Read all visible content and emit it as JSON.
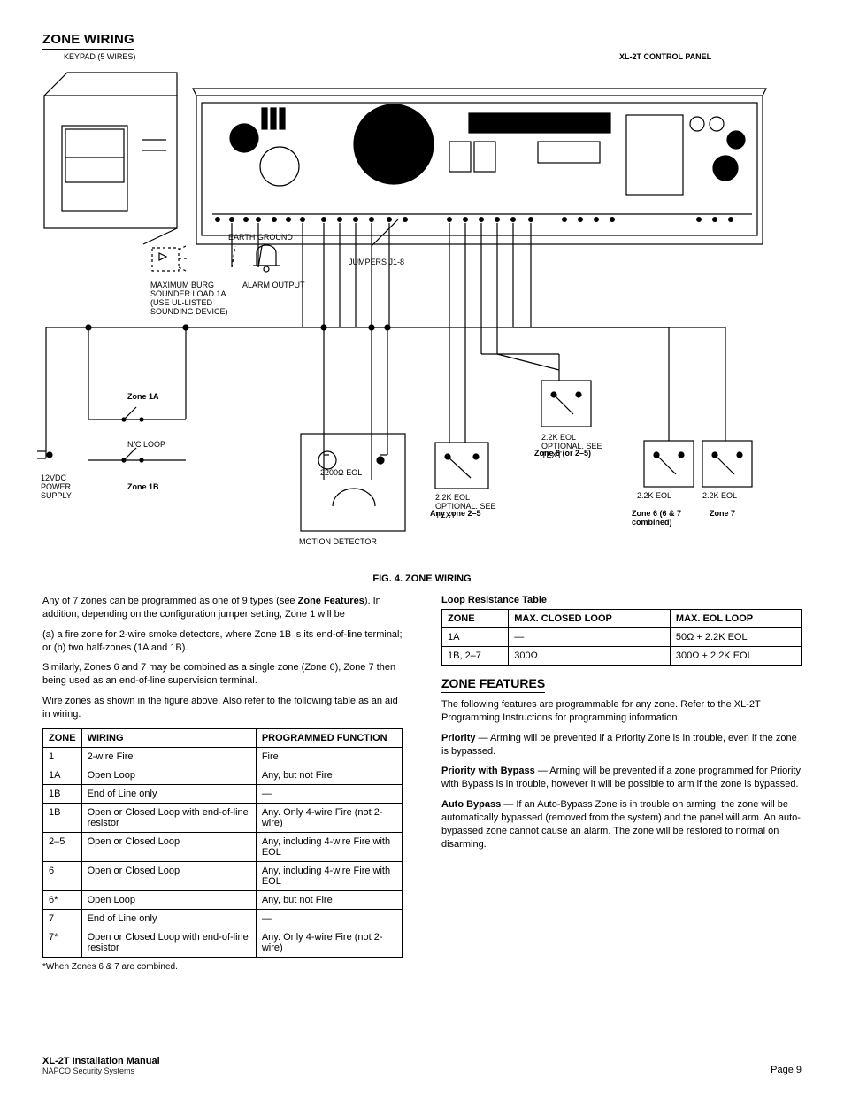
{
  "page": {
    "title": "ZONE WIRING",
    "footer_line1": "XL-2T Installation Manual",
    "footer_line2": "NAPCO Security Systems",
    "page_number": "Page 9"
  },
  "diagram": {
    "figure_caption": "FIG. 4.  ZONE WIRING",
    "keypad_label": "KEYPAD (5 WIRES)",
    "control_label": "XL-2T CONTROL PANEL",
    "jumper_label": "JUMPERS J1-8",
    "earth_label": "EARTH GROUND",
    "siren_note": "MAXIMUM BURG SOUNDER LOAD 1A (USE UL-LISTED SOUNDING DEVICE)",
    "alarm_label": "ALARM OUTPUT",
    "power_label": "12VDC POWER SUPPLY",
    "detector_label": "MOTION DETECTOR",
    "detector_eol": "2200Ω EOL",
    "nc_loop": "N/C LOOP",
    "eol_generic": "2.2K EOL",
    "eol_optional": "2.2K EOL OPTIONAL. SEE TEXT",
    "zones": {
      "z1a": "Zone 1A",
      "z1b": "Zone 1B",
      "z2_5": "Any zone 2–5",
      "z6": "Zone 6 (or 2–5)",
      "z6_combo": "Zone 6 (6 & 7 combined)",
      "z7": "Zone 7"
    }
  },
  "column_text": {
    "intro_p1": "Any of 7 zones can be programmed as one of 9 types (see",
    "intro_p2b": "Zone Features",
    "intro_p2c": "). In addition, depending on the configuration jumper setting, Zone 1 will be",
    "intro_p3": "(a) a fire zone for 2-wire smoke detectors, where Zone 1B is its end-of-line terminal; or (b) two half-zones (1A and 1B).",
    "intro_p4": "Similarly, Zones 6 and 7 may be combined as a single zone (Zone 6), Zone 7 then being used as an end-of-line supervision terminal.",
    "intro_p5": "Wire zones as shown in the figure above. Also refer to the following table as an aid in wiring."
  },
  "zone_table": {
    "head_zone": "ZONE",
    "head_wiring": "WIRING",
    "head_function": "PROGRAMMED FUNCTION",
    "rows": [
      {
        "zone": "1",
        "wire": "2-wire Fire",
        "func": "Fire"
      },
      {
        "zone": "1A",
        "wire": "Open Loop",
        "func": "Any, but not Fire"
      },
      {
        "zone": "1B",
        "wire": "End of Line only",
        "func": "—"
      },
      {
        "zone": "1B",
        "wire": "Open or Closed Loop with end-of-line resistor",
        "func": "Any. Only 4-wire Fire (not 2-wire)"
      },
      {
        "zone": "2–5",
        "wire": "Open or Closed Loop",
        "func": "Any, including 4-wire Fire with EOL"
      },
      {
        "zone": "6",
        "wire": "Open or Closed Loop",
        "func": "Any, including 4-wire Fire with EOL"
      },
      {
        "zone": "6*",
        "wire": "Open Loop",
        "func": "Any, but not Fire"
      },
      {
        "zone": "7",
        "wire": "End of Line only",
        "func": "—"
      },
      {
        "zone": "7*",
        "wire": "Open or Closed Loop with end-of-line resistor",
        "func": "Any. Only 4-wire Fire (not 2-wire)"
      }
    ],
    "footnote": "*When Zones 6 & 7 are combined."
  },
  "loop_res": {
    "title": "Loop Resistance Table",
    "head_zone": "ZONE",
    "head_max_closed": "MAX. CLOSED LOOP",
    "head_max_eol": "MAX. EOL LOOP",
    "rows": [
      {
        "zone": "1A",
        "closed": "—",
        "eol": "50Ω + 2.2K EOL"
      },
      {
        "zone": "1B, 2–7",
        "closed": "300Ω",
        "eol": "300Ω + 2.2K EOL"
      }
    ]
  },
  "zone_features": {
    "title": "ZONE FEATURES",
    "p1a": "The following features are programmable for any zone. Refer to the XL-2T Programming Instructions for programming information.",
    "priority_title": "Priority",
    "priority_body": "Arming will be prevented if a Priority Zone is in trouble, even if the zone is bypassed.",
    "priority_bypass_title": "Priority with Bypass",
    "priority_bypass_body": "Arming will be prevented if a zone programmed for Priority with Bypass is in trouble, however it will be possible to arm if the zone is bypassed.",
    "auto_bypass_title": "Auto Bypass",
    "auto_bypass_body": "If an Auto-Bypass Zone is in trouble on arming, the zone will be automatically bypassed (removed from the system) and the panel will arm. An auto-bypassed zone cannot cause an alarm. The zone will be restored to normal on disarming."
  }
}
